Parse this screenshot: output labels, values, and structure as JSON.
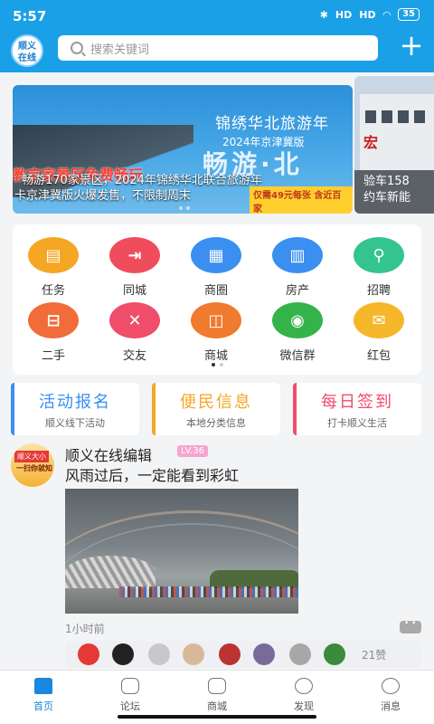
{
  "status": {
    "time": "5:57",
    "signal1": "HD",
    "signal2": "HD",
    "battery": "35"
  },
  "header": {
    "logo_text_line1": "顺义",
    "logo_text_line2": "在线",
    "search_placeholder": "搜索关键词",
    "plus_label": "+"
  },
  "banner": {
    "title": "锦绣华北旅游年",
    "subtitle": "2024年京津冀版",
    "big_text": "畅游·北",
    "red_text": "教京家景区免费畅玩",
    "white_line1": "畅游170家景区，2024年锦绣华北联合旅游年",
    "white_line2": "卡京津冀版火爆发售，不限制周末",
    "promo": "仅需49元每张 含近百家",
    "side_sign": "宏",
    "side_caption_line1": "验车158",
    "side_caption_line2": "约车新能"
  },
  "menu": [
    {
      "label": "任务",
      "icon": "clipboard-icon",
      "color": "#f5a623"
    },
    {
      "label": "同城",
      "icon": "signpost-icon",
      "color": "#ef4d5c"
    },
    {
      "label": "商圈",
      "icon": "store-icon",
      "color": "#3a8ff0"
    },
    {
      "label": "房产",
      "icon": "building-icon",
      "color": "#3a8ff0"
    },
    {
      "label": "招聘",
      "icon": "recruit-icon",
      "color": "#33c48f"
    },
    {
      "label": "二手",
      "icon": "basket-icon",
      "color": "#f26b3a"
    },
    {
      "label": "交友",
      "icon": "friends-icon",
      "color": "#ef4d6a"
    },
    {
      "label": "商城",
      "icon": "shopping-bag-icon",
      "color": "#f07a2e"
    },
    {
      "label": "微信群",
      "icon": "wechat-icon",
      "color": "#34b34a"
    },
    {
      "label": "红包",
      "icon": "red-envelope-icon",
      "color": "#f6b62a"
    }
  ],
  "quick": [
    {
      "title": "活动报名",
      "sub": "顺义线下活动",
      "color": "#3a8ff0"
    },
    {
      "title": "便民信息",
      "sub": "本地分类信息",
      "color": "#f5a623"
    },
    {
      "title": "每日签到",
      "sub": "打卡顺义生活",
      "color": "#ef4d6a"
    }
  ],
  "post": {
    "avatar_tag": "顺义大小",
    "avatar_sub": "一扫你就知",
    "author": "顺义在线编辑",
    "level": "LV.36",
    "text": "风雨过后，一定能看到彩虹",
    "time": "1小时前",
    "likes": "21赞"
  },
  "tabs": [
    {
      "label": "首页",
      "active": true
    },
    {
      "label": "论坛",
      "active": false
    },
    {
      "label": "商城",
      "active": false
    },
    {
      "label": "发现",
      "active": false
    },
    {
      "label": "消息",
      "active": false
    }
  ]
}
